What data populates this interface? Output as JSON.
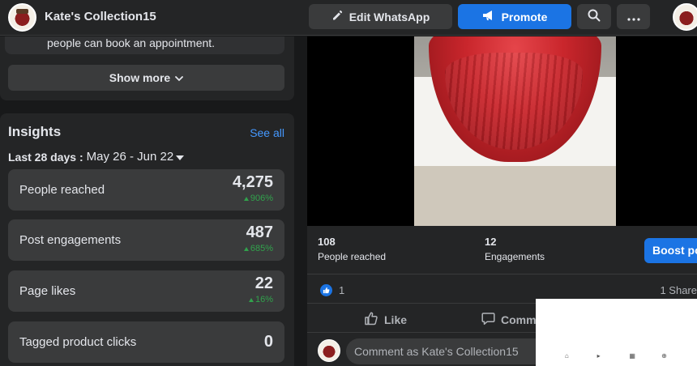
{
  "header": {
    "page_title": "Kate's Collection15",
    "whatsapp_label": "Edit WhatsApp",
    "promote_label": "Promote"
  },
  "about": {
    "text": "people can book an appointment.",
    "show_more_label": "Show more"
  },
  "insights": {
    "title": "Insights",
    "see_all_label": "See all",
    "period_label": "Last 28 days :",
    "period_range": "May 26 - Jun 22",
    "metrics": [
      {
        "label": "People reached",
        "value": "4,275",
        "change": "906%"
      },
      {
        "label": "Post engagements",
        "value": "487",
        "change": "685%"
      },
      {
        "label": "Page likes",
        "value": "22",
        "change": "16%"
      },
      {
        "label": "Tagged product clicks",
        "value": "0"
      }
    ]
  },
  "post": {
    "reached_value": "108",
    "reached_label": "People reached",
    "engagements_value": "12",
    "engagements_label": "Engagements",
    "boost_label": "Boost post",
    "reaction_count": "1",
    "shares_text": "1 Share",
    "like_label": "Like",
    "comment_label": "Comment",
    "comment_placeholder": "Comment as Kate's Collection15"
  },
  "colors": {
    "background": "#18191a",
    "card": "#242526",
    "accent_blue": "#1b74e4",
    "link_blue": "#4599ff",
    "positive_green": "#31a24c"
  },
  "icons": {
    "whatsapp": "pencil-icon",
    "promote": "megaphone-icon",
    "search": "search-icon",
    "more": "ellipsis-icon",
    "show_more": "chevron-down-icon",
    "period": "caret-down-icon",
    "like": "thumbs-up-icon",
    "comment": "speech-bubble-icon"
  }
}
